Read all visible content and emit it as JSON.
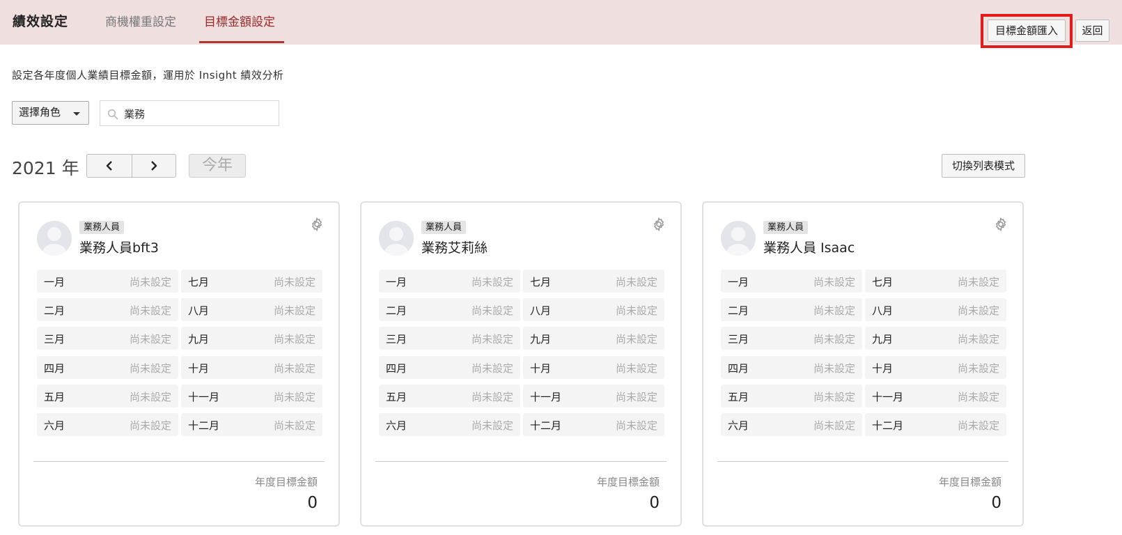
{
  "header": {
    "title": "績效設定",
    "tabs": [
      {
        "label": "商機權重設定",
        "active": false
      },
      {
        "label": "目標金額設定",
        "active": true
      }
    ],
    "import_label": "目標金額匯入",
    "back_label": "返回"
  },
  "description": "設定各年度個人業績目標金額，運用於 Insight 績效分析",
  "filters": {
    "role_select": "選擇角色",
    "search_value": "業務"
  },
  "year_nav": {
    "year_label": "2021 年",
    "today_label": "今年",
    "list_mode_label": "切換列表模式"
  },
  "months_left": [
    "一月",
    "二月",
    "三月",
    "四月",
    "五月",
    "六月"
  ],
  "months_right": [
    "七月",
    "八月",
    "九月",
    "十月",
    "十一月",
    "十二月"
  ],
  "cards": [
    {
      "role": "業務人員",
      "name": "業務人員bft3",
      "value_text": "尚未設定",
      "total_label": "年度目標金額",
      "total": "0"
    },
    {
      "role": "業務人員",
      "name": "業務艾莉絲",
      "value_text": "尚未設定",
      "total_label": "年度目標金額",
      "total": "0"
    },
    {
      "role": "業務人員",
      "name": "業務人員 Isaac",
      "value_text": "尚未設定",
      "total_label": "年度目標金額",
      "total": "0"
    }
  ],
  "colors": {
    "header_bg": "#efdfdf",
    "active_tab": "#9b2a2a",
    "highlight": "#e41b1b"
  }
}
